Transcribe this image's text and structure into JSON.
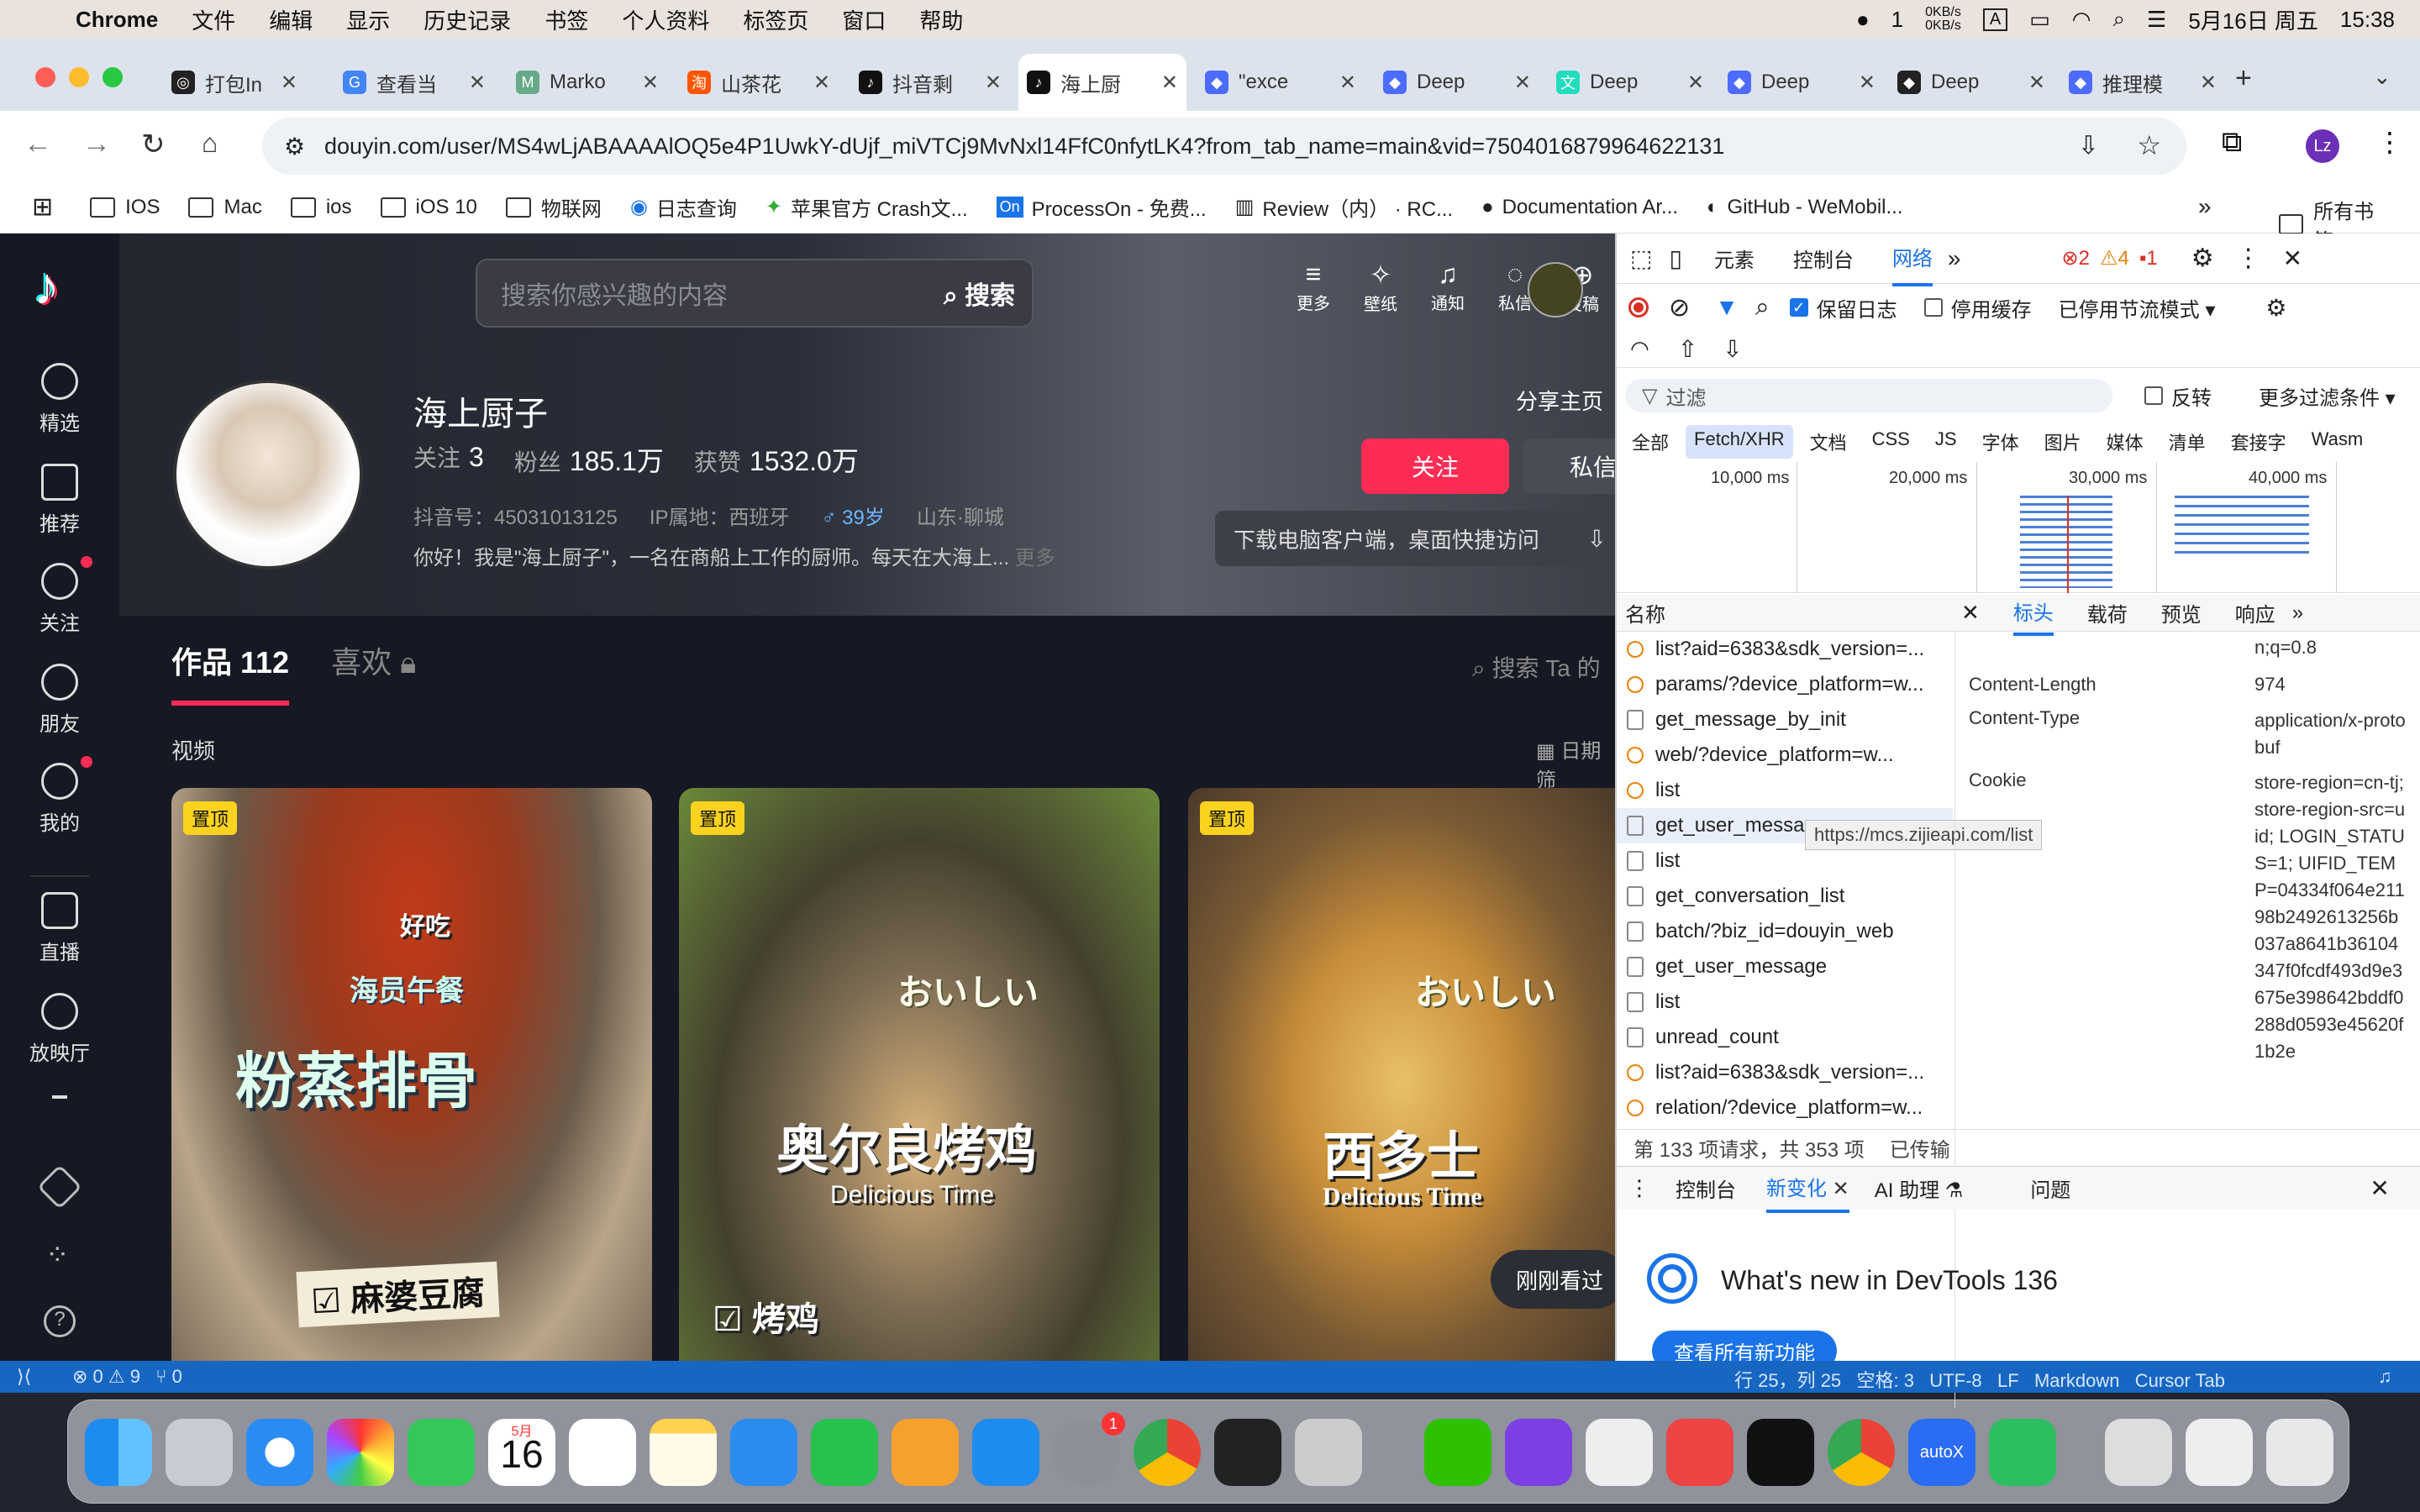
{
  "menubar": {
    "app": "Chrome",
    "items": [
      "文件",
      "编辑",
      "显示",
      "历史记录",
      "书签",
      "个人资料",
      "标签页",
      "窗口",
      "帮助"
    ],
    "net_speed": "0KB/s\n0KB/s",
    "badge": "1",
    "input_mode": "A",
    "date": "5月16日 周五",
    "time": "15:38"
  },
  "tabs": [
    {
      "label": "打包In",
      "fav": "◎"
    },
    {
      "label": "查看当",
      "fav": "G"
    },
    {
      "label": "Marko",
      "fav": "M"
    },
    {
      "label": "山茶花",
      "fav": "淘"
    },
    {
      "label": "抖音剩",
      "fav": "♪"
    },
    {
      "label": "海上厨",
      "fav": "♪"
    },
    {
      "label": "\"exce",
      "fav": "◆"
    },
    {
      "label": "Deep",
      "fav": "◆"
    },
    {
      "label": "Deep",
      "fav": "文"
    },
    {
      "label": "Deep",
      "fav": "◆"
    },
    {
      "label": "Deep",
      "fav": "◆"
    },
    {
      "label": "推理模",
      "fav": "◆"
    }
  ],
  "url": "douyin.com/user/MS4wLjABAAAAlOQ5e4P1UwkY-dUjf_miVTCj9MvNxl14FfC0nfytLK4?from_tab_name=main&vid=7504016879964622131",
  "profile_initials": "Lz",
  "bookmarks": [
    "IOS",
    "Mac",
    "ios",
    "iOS 10",
    "物联网",
    "日志查询",
    "苹果官方 Crash文...",
    "ProcessOn - 免费...",
    "Review（内） · RC...",
    "Documentation Ar...",
    "GitHub - WeMobil..."
  ],
  "bookmarks_all": "所有书签",
  "sidebar": [
    "精选",
    "推荐",
    "关注",
    "朋友",
    "我的",
    "直播",
    "放映厅"
  ],
  "search": {
    "placeholder": "搜索你感兴趣的内容",
    "button": "搜索"
  },
  "topicons": [
    "更多",
    "壁纸",
    "通知",
    "私信",
    "投稿"
  ],
  "profile": {
    "name": "海上厨子",
    "follow_label": "关注",
    "follow_count": "3",
    "fans_label": "粉丝",
    "fans_count": "185.1万",
    "likes_label": "获赞",
    "likes_count": "1532.0万",
    "id": "抖音号：45031013125",
    "ip": "IP属地：西班牙",
    "age": "♂ 39岁",
    "region": "山东·聊城",
    "bio": "你好！我是\"海上厨子\"，一名在商船上工作的厨师。每天在大海上...",
    "more": "更多",
    "follow_btn": "关注",
    "msg_btn": "私信",
    "share_home": "分享主页",
    "download": "下载电脑客户端，桌面快捷访问"
  },
  "content_tabs": {
    "works": "作品 112",
    "likes": "喜欢"
  },
  "video_label": "视频",
  "ta_search": "搜索 Ta 的",
  "date_filter": "日期筛",
  "cards": [
    {
      "pin": "置顶",
      "t1": "海员午餐",
      "t2": "粉蒸排骨",
      "t3": "☑ 麻婆豆腐",
      "tag": "好吃"
    },
    {
      "pin": "置顶",
      "t1": "おいしい",
      "t2": "奥尔良烤鸡",
      "t3": "Delicious Time",
      "t4": "☑ 烤鸡"
    },
    {
      "pin": "置顶",
      "t1": "おいしい",
      "t2": "西多士",
      "t3": "Delicious Time"
    }
  ],
  "just_now": "刚刚看过",
  "devtools": {
    "tabs": [
      "元素",
      "控制台",
      "网络"
    ],
    "errors": "2",
    "warnings": "4",
    "issues": "1",
    "preserve_log": "保留日志",
    "disable_cache": "停用缓存",
    "throttle": "已停用节流模式",
    "filter": "过滤",
    "invert": "反转",
    "more_filters": "更多过滤条件",
    "chips": [
      "全部",
      "Fetch/XHR",
      "文档",
      "CSS",
      "JS",
      "字体",
      "图片",
      "媒体",
      "清单",
      "套接字",
      "Wasm"
    ],
    "timeline": [
      "10,000 ms",
      "20,000 ms",
      "30,000 ms",
      "40,000 ms"
    ],
    "name_col": "名称",
    "detail_tabs": [
      "标头",
      "载荷",
      "预览",
      "响应"
    ],
    "requests": [
      {
        "n": "list?aid=6383&sdk_version=...",
        "x": true
      },
      {
        "n": "params/?device_platform=w...",
        "x": true
      },
      {
        "n": "get_message_by_init",
        "x": false
      },
      {
        "n": "web/?device_platform=w...",
        "x": true
      },
      {
        "n": "list",
        "x": true
      },
      {
        "n": "get_user_message",
        "x": false
      },
      {
        "n": "list",
        "x": false
      },
      {
        "n": "get_conversation_list",
        "x": false
      },
      {
        "n": "batch/?biz_id=douyin_web",
        "x": false
      },
      {
        "n": "get_user_message",
        "x": false
      },
      {
        "n": "list",
        "x": false
      },
      {
        "n": "unread_count",
        "x": false
      },
      {
        "n": "list?aid=6383&sdk_version=...",
        "x": true
      },
      {
        "n": "relation/?device_platform=w...",
        "x": true
      }
    ],
    "tooltip": "https://mcs.zijieapi.com/list",
    "headers": [
      {
        "k": "",
        "v": "n;q=0.8"
      },
      {
        "k": "Content-Length",
        "v": "974"
      },
      {
        "k": "Content-Type",
        "v": "application/x-protobuf"
      },
      {
        "k": "Cookie",
        "v": "store-region=cn-tj; store-region-src=uid; LOGIN_STATUS=1; UIFID_TEMP=04334f064e21198b2492613256b037a8641b36104347f0fcdf493d9e3675e398642bddf0288d0593e45620f1b2e"
      }
    ],
    "footer": "第 133 项请求，共 353 项",
    "footer2": "已传输",
    "drawer_tabs": [
      "控制台",
      "新变化",
      "AI 助理",
      "问题"
    ],
    "whatsnew": "What's new in DevTools 136",
    "whatsnew_btn": "查看所有新功能"
  },
  "statusbar": {
    "left": "⊗ 0 ⚠ 9   ⑂ 0",
    "right": "行 25，列 25   空格: 3   UTF-8   LF   Markdown   Cursor Tab"
  },
  "dock": {
    "calendar_month": "5月",
    "calendar_day": "16",
    "badge": "1",
    "autox": "autoX"
  },
  "colors": {
    "accent": "#fe2c55",
    "devtools_blue": "#1a73e8",
    "status_blue": "#1766c2"
  }
}
